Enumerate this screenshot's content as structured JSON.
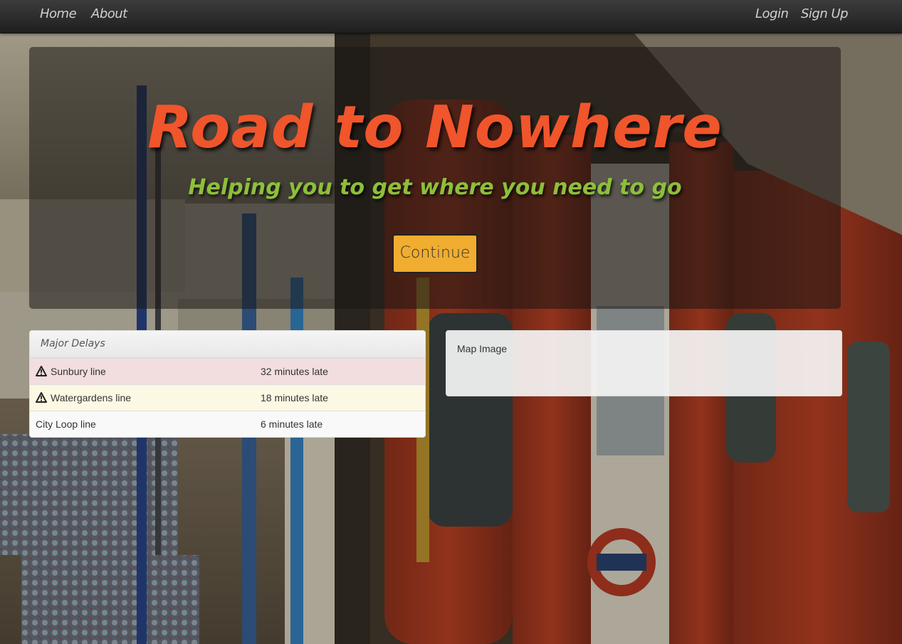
{
  "nav": {
    "left": [
      {
        "label": "Home"
      },
      {
        "label": "About"
      }
    ],
    "right": [
      {
        "label": "Login"
      },
      {
        "label": "Sign Up"
      }
    ]
  },
  "hero": {
    "title": "Road to Nowhere",
    "subtitle": "Helping you to get where you need to go",
    "button_label": "Continue",
    "title_color": "#f0552c",
    "subtitle_color": "#8dbf3a",
    "button_color": "#f0ad30"
  },
  "delays": {
    "heading": "Major Delays",
    "rows": [
      {
        "line": "Sunbury line",
        "delay": "32 minutes late",
        "status": "danger",
        "icon": "warning-icon"
      },
      {
        "line": "Watergardens line",
        "delay": "18 minutes late",
        "status": "warning",
        "icon": "warning-icon"
      },
      {
        "line": "City Loop line",
        "delay": "6 minutes late",
        "status": "plain",
        "icon": ""
      }
    ]
  },
  "map": {
    "label": "Map Image"
  }
}
